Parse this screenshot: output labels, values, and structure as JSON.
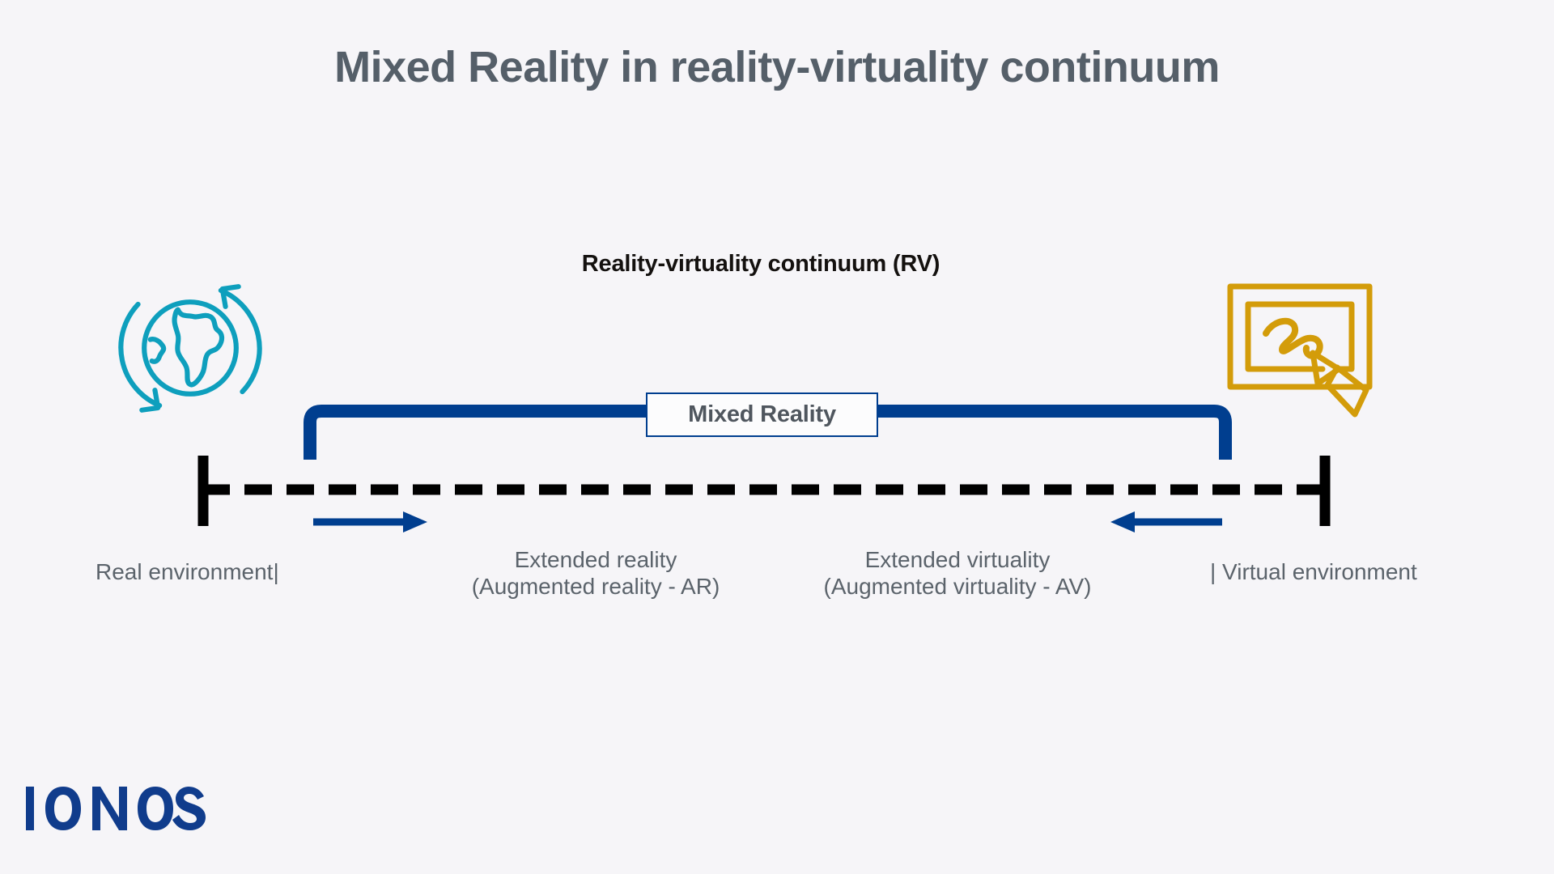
{
  "page": {
    "title": "Mixed Reality in reality-virtuality continuum",
    "background_color": "#f6f5f8",
    "title_color": "#555f69"
  },
  "diagram": {
    "subtitle": "Reality-virtuality continuum (RV)",
    "subtitle_color": "#14110f",
    "bracket_label": "Mixed Reality",
    "bracket_color": "#003e8f",
    "axis_color": "#000000",
    "endpoints": {
      "left": "Real environment|",
      "right": "| Virtual environment"
    },
    "zones": [
      {
        "name": "extended-reality",
        "line1": "Extended reality",
        "line2": "(Augmented reality - AR)",
        "arrow_direction": "right"
      },
      {
        "name": "extended-virtuality",
        "line1": "Extended virtuality",
        "line2": "(Augmented virtuality - AV)",
        "arrow_direction": "left"
      }
    ],
    "icons": {
      "left": "globe-refresh-icon",
      "left_color": "#0e9fbd",
      "right": "drawing-tablet-stylus-icon",
      "right_color": "#d39c0a"
    }
  },
  "branding": {
    "wordmark": "IONOS",
    "wordmark_color": "#103c8c"
  }
}
